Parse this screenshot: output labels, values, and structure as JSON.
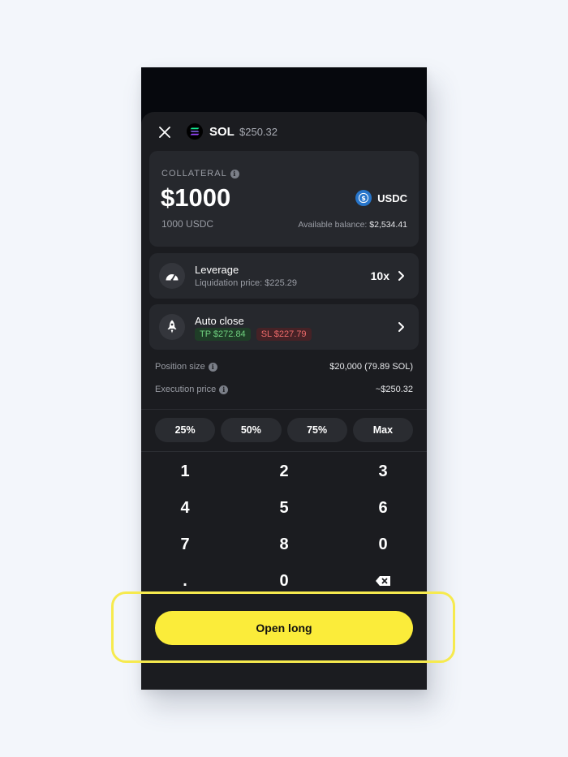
{
  "header": {
    "token": "SOL",
    "price": "$250.32"
  },
  "collateral": {
    "label": "COLLATERAL",
    "amount": "$1000",
    "sub": "1000 USDC",
    "currency": "USDC",
    "available_label": "Available balance:",
    "available_value": "$2,534.41"
  },
  "leverage": {
    "title": "Leverage",
    "sub": "Liquidation price: $225.29",
    "value": "10x"
  },
  "auto_close": {
    "title": "Auto close",
    "tp": "TP $272.84",
    "sl": "SL $227.79"
  },
  "details": {
    "position_size_label": "Position size",
    "position_size_value": "$20,000 (79.89 SOL)",
    "execution_price_label": "Execution price",
    "execution_price_value": "~$250.32"
  },
  "percent_buttons": [
    "25%",
    "50%",
    "75%",
    "Max"
  ],
  "keypad": {
    "k1": "1",
    "k2": "2",
    "k3": "3",
    "k4": "4",
    "k5": "5",
    "k6": "6",
    "k7": "7",
    "k8": "8",
    "k9": "0",
    "kdot": ".",
    "k0": "0"
  },
  "action": {
    "label": "Open long"
  },
  "colors": {
    "accent": "#fbec3a",
    "tp": "#6fd07f",
    "sl": "#ee6b6b",
    "usdc": "#2775ca"
  },
  "icons": {
    "close": "close-icon",
    "token": "solana-logo-icon",
    "currency": "usdc-logo-icon",
    "info": "info-icon",
    "leverage": "speedometer-icon",
    "auto_close": "rocket-icon",
    "chevron": "chevron-right-icon",
    "backspace": "backspace-icon"
  }
}
